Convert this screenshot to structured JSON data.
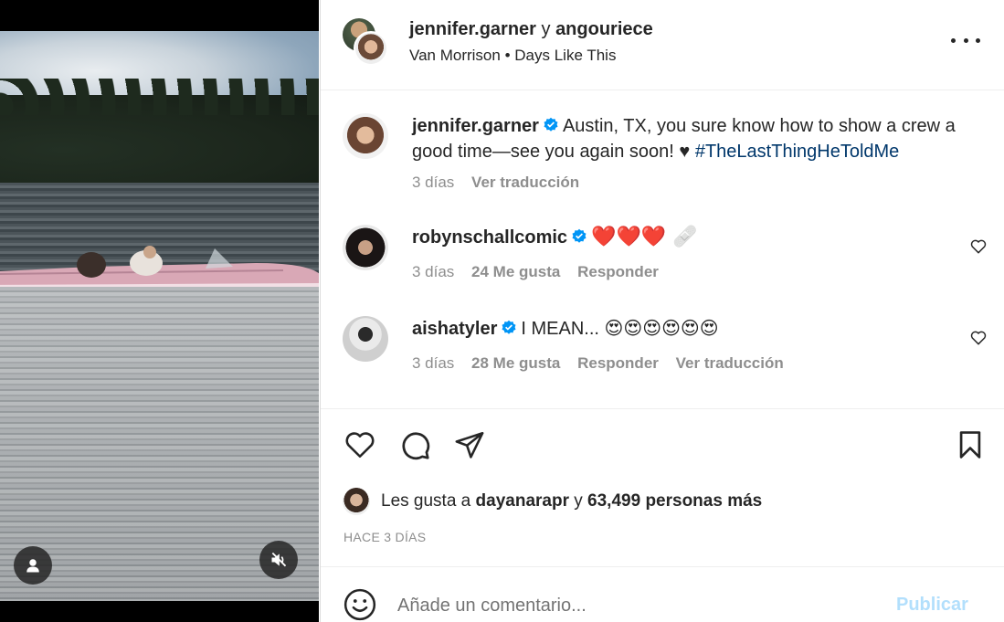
{
  "post": {
    "owner_1": "jennifer.garner",
    "joiner": "y",
    "owner_2": "angouriece",
    "audio_artist": "Van Morrison",
    "audio_separator": "•",
    "audio_song": "Days Like This"
  },
  "caption": {
    "user": "jennifer.garner",
    "text": "Austin, TX, you sure know how to show a crew a good time—see you again soon! ♥ ",
    "hashtag": "#TheLastThingHeToldMe",
    "time": "3 días",
    "translate": "Ver traducción"
  },
  "comments": [
    {
      "user": "robynschallcomic",
      "text": "❤️❤️❤️ 🩹",
      "time": "3 días",
      "likes": "24 Me gusta",
      "reply": "Responder"
    },
    {
      "user": "aishatyler",
      "text": "I MEAN... 😍😍😍😍😍😍",
      "time": "3 días",
      "likes": "28 Me gusta",
      "reply": "Responder",
      "translate": "Ver traducción"
    }
  ],
  "likes": {
    "prefix": "Les gusta a",
    "user": "dayanarapr",
    "connector": "y",
    "others": "63,499 personas más"
  },
  "timestamp": "HACE 3 DÍAS",
  "add_comment": {
    "placeholder": "Añade un comentario...",
    "publish_label": "Publicar"
  },
  "icons": {
    "like": "heart-icon",
    "comment": "comment-icon",
    "share": "send-icon",
    "save": "bookmark-icon",
    "emoji": "smile-icon",
    "mute": "speaker-muted-icon",
    "user_tag": "person-icon",
    "more": "more-icon"
  },
  "colors": {
    "verified": "#0095f6",
    "hashtag": "#00376b",
    "publish_disabled": "#b2dffc",
    "secondary_text": "#8e8e8e"
  }
}
